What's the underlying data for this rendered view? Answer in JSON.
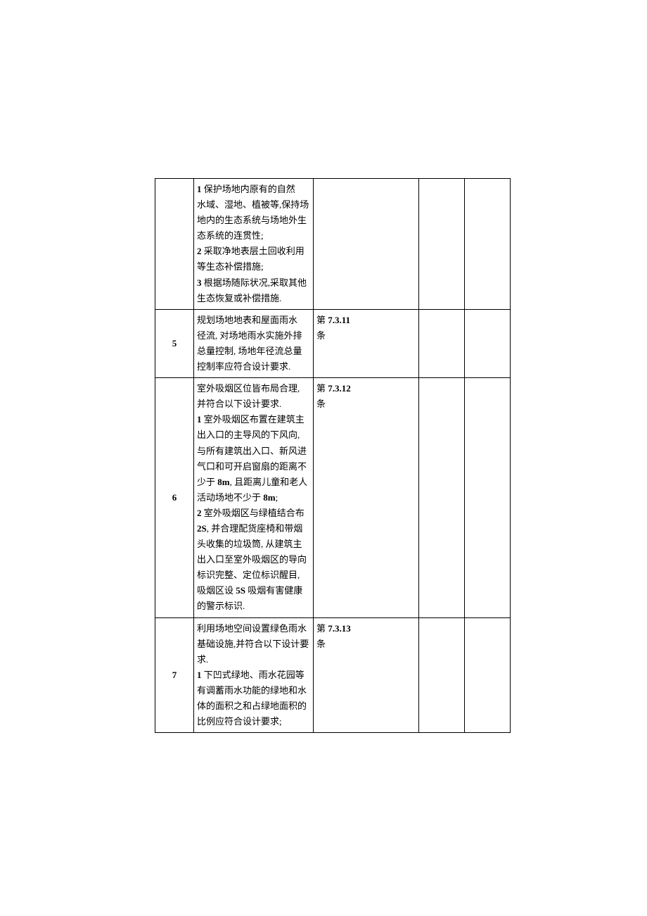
{
  "rows": [
    {
      "num": "",
      "desc": "1 保护场地内原有的自然\n水域、湿地、植被等,保持场地内的生态系统与场地外生态系统的连贯性;\n2 采取净地表层土回收利用等生态补偿措施;\n3 根据场随际状况,采取其他生态恢复或补偿措施.",
      "ref": ""
    },
    {
      "num": "5",
      "desc": "规划场地地表和屋面雨水\n径流, 对场地雨水实施外排总量控制, 场地年径流总量控制率应符合设计要求.",
      "ref": "第 7.3.11\n条"
    },
    {
      "num": "6",
      "desc": "\n室外吸烟区位皆布局合理, 并符合以下设计要求.\n1 室外吸烟区布置在建筑主出入口的主导风的下风向, 与所有建筑出入口、新风进气口和可开启窗扇的距离不少于 8m, 且距离儿童和老人活动场地不少于 8m;\n2 室外吸烟区与绿植结合布 2S, 并合理配货座椅和带烟头收集的垃圾筒, 从建筑主出入口至室外吸烟区的导向标识完整、定位标识醒目, 吸烟区设 5S 吸烟有害健康的警示标识.",
      "ref": "第 7.3.12\n条"
    },
    {
      "num": "7",
      "desc": "利用场地空间设置绿色雨水基础设施,并符合以下设计要求.\n1 下凹式绿地、雨水花园等有调蓄雨水功能的绿地和水体的面积之和占绿地面积的比例应符合设计要求;",
      "ref": "第 7.3.13\n条"
    }
  ]
}
